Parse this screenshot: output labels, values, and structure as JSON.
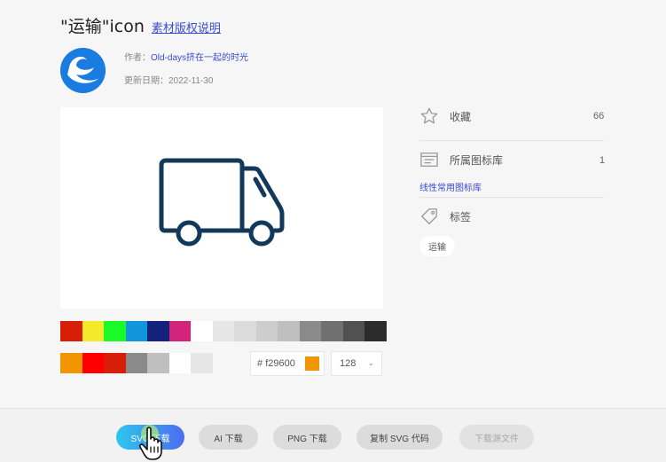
{
  "header": {
    "title": "\"运输\"icon",
    "license_link": "素材版权说明"
  },
  "author": {
    "label": "作者：",
    "name": "Old-days挤在一起的时光",
    "date_label": "更新日期：",
    "date": "2022-11-30"
  },
  "preview": {
    "icon": "truck-icon",
    "color": "#12385a"
  },
  "palette": {
    "row1": [
      "#d81e06",
      "#f4ea2a",
      "#1afa29",
      "#1296db",
      "#13227a",
      "#d4237a",
      "#ffffff",
      "#e6e6e6",
      "#dbdbdb",
      "#cdcdcd",
      "#bfbfbf",
      "#8a8a8a",
      "#707070",
      "#515151",
      "#2c2c2c"
    ],
    "row2": [
      "#f29600",
      "#ff0000",
      "#d81e06",
      "#8a8a8a",
      "#bfbfbf",
      "#ffffff",
      "#e6e6e6"
    ]
  },
  "controls": {
    "hex_prefix": "#",
    "hex_value": "f29600",
    "size_value": "128"
  },
  "sidebar": {
    "favorites_label": "收藏",
    "favorites_count": "66",
    "library_label": "所属图标库",
    "library_count": "1",
    "library_link": "线性常用图标库",
    "tags_label": "标签",
    "tag": "运输"
  },
  "actions": {
    "svg_download": "SVG 下载",
    "ai_download": "AI 下载",
    "png_download": "PNG 下载",
    "copy_svg": "复制 SVG 代码",
    "source_download": "下载源文件"
  }
}
